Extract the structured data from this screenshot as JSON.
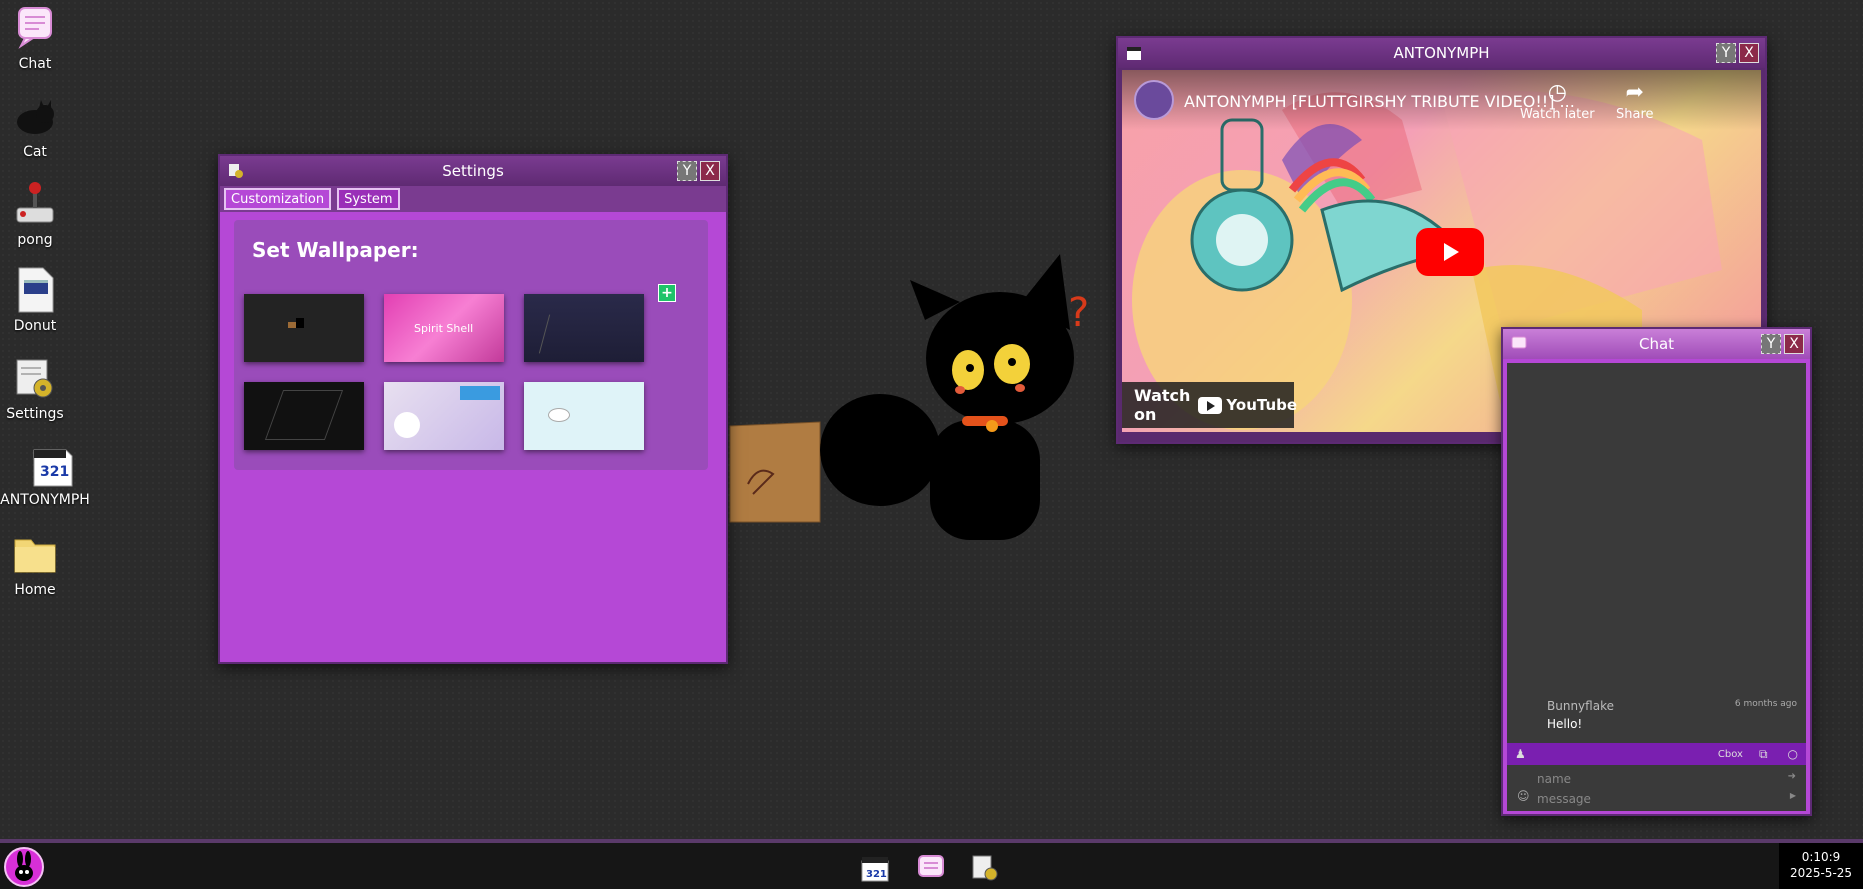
{
  "desktop": {
    "icons": [
      {
        "label": "Chat",
        "icon": "chat-icon"
      },
      {
        "label": "Cat",
        "icon": "cat-icon"
      },
      {
        "label": "pong",
        "icon": "joystick-icon"
      },
      {
        "label": "Donut",
        "icon": "terminal-icon"
      },
      {
        "label": "Settings",
        "icon": "settings-icon"
      },
      {
        "label": "ANTONYMPH",
        "icon": "clapperboard-icon"
      },
      {
        "label": "Home",
        "icon": "folder-icon"
      }
    ]
  },
  "settings": {
    "title": "Settings",
    "min_label": "Y",
    "close_label": "X",
    "tabs": [
      "Customization",
      "System"
    ],
    "active_tab": "Customization",
    "heading": "Set Wallpaper:",
    "add_label": "+",
    "thumb_text": "Spirit Shell",
    "wallpapers": [
      "wallpaper-1",
      "wallpaper-2",
      "wallpaper-3",
      "wallpaper-4",
      "wallpaper-5",
      "wallpaper-6"
    ]
  },
  "video": {
    "title": "ANTONYMPH",
    "min_label": "Y",
    "close_label": "X",
    "video_title": "ANTONYMPH [FLUTTGIRSHY TRIBUTE VIDEO!!] ...",
    "watch_later": "Watch later",
    "share": "Share",
    "watch_on": "Watch on",
    "youtube": "YouTube"
  },
  "chat": {
    "title": "Chat",
    "min_label": "Y",
    "close_label": "X",
    "message": {
      "user": "Bunnyflake",
      "time": "6 months ago",
      "text": "Hello!"
    },
    "bar_label": "Cbox",
    "name_placeholder": "name",
    "message_placeholder": "message"
  },
  "taskbar": {
    "clock_time": "0:10:9",
    "clock_date": "2025-5-25"
  },
  "colors": {
    "window_purple": "#b548d6",
    "titlebar": "#7a3b90",
    "add_green": "#1fc36a",
    "yt_red": "#ff0000"
  }
}
